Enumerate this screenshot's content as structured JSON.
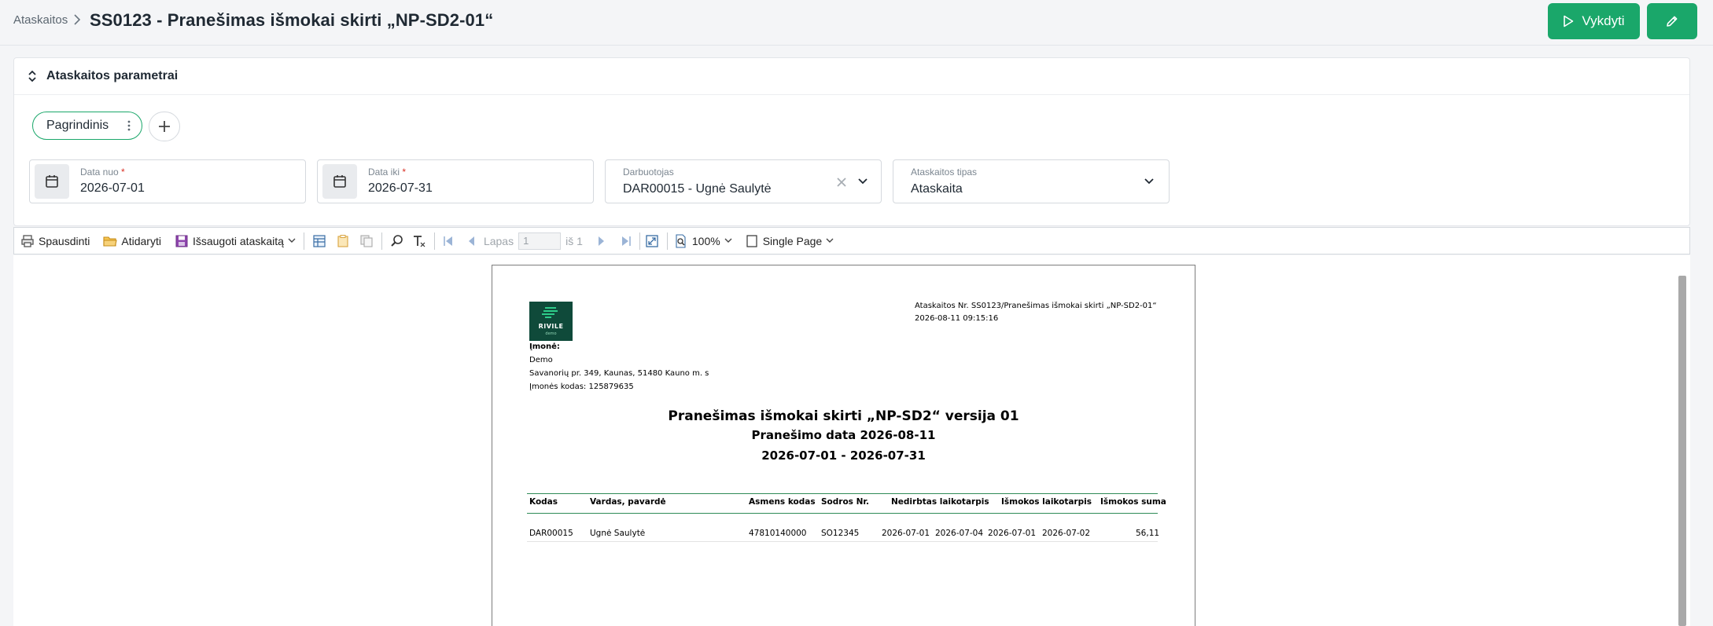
{
  "header": {
    "breadcrumb": "Ataskaitos",
    "title": "SS0123 - Pranešimas išmokai skirti „NP-SD2-01“",
    "run_label": "Vykdyti"
  },
  "params": {
    "title": "Ataskaitos parametrai",
    "chip_label": "Pagrindinis",
    "date_from": {
      "label": "Data nuo",
      "required": "*",
      "value": "2026-07-01"
    },
    "date_to": {
      "label": "Data iki",
      "required": "*",
      "value": "2026-07-31"
    },
    "employee": {
      "label": "Darbuotojas",
      "value": "DAR00015 - Ugnė Saulytė"
    },
    "report_type": {
      "label": "Ataskaitos tipas",
      "value": "Ataskaita"
    }
  },
  "toolbar": {
    "print": "Spausdinti",
    "open": "Atidaryti",
    "save": "Išsaugoti ataskaitą",
    "page_label": "Lapas",
    "page_value": "1",
    "page_of": "iš 1",
    "zoom": "100%",
    "single_page": "Single Page"
  },
  "report": {
    "logo": "RIVILE",
    "logo_sub": "demo",
    "report_no": "Ataskaitos Nr. SS0123/Pranešimas išmokai skirti „NP-SD2-01“",
    "generated": "2026-08-11 09:15:16",
    "company_label": "Įmonė:",
    "company_name": "Demo",
    "company_address": "Savanorių pr. 349, Kaunas, 51480 Kauno m. s",
    "company_code": "Įmonės kodas: 125879635",
    "title": "Pranešimas išmokai skirti „NP-SD2“  versija 01",
    "subtitle": "Pranešimo data 2026-08-11",
    "period": "2026-07-01 - 2026-07-31",
    "columns": [
      "Kodas",
      "Vardas, pavardė",
      "Asmens kodas",
      "Sodros Nr.",
      "Nedirbtas laikotarpis",
      "Išmokos laikotarpis",
      "Išmokos suma"
    ],
    "row": {
      "code": "DAR00015",
      "name": "Ugnė Saulytė",
      "personal_code": "47810140000",
      "sodra_no": "SO12345",
      "unworked_from": "2026-07-01",
      "unworked_to": "2026-07-04",
      "paid_from": "2026-07-01",
      "paid_to": "2026-07-02",
      "amount": "56,11"
    }
  },
  "colors": {
    "accent": "#1aa76a",
    "logo_bg": "#0f4a3a"
  }
}
